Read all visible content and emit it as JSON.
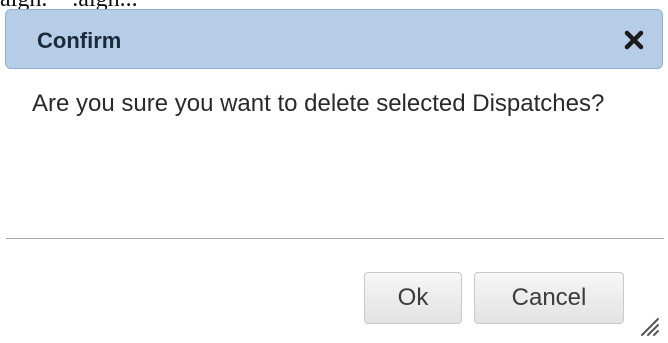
{
  "background_text": "aigh. ~ .aigh...",
  "dialog": {
    "title": "Confirm",
    "close_icon": "close-icon",
    "message": "Are you sure you want to delete selected Dispatches?",
    "ok_label": "Ok",
    "cancel_label": "Cancel",
    "resize_icon": "resize-grip-icon"
  },
  "colors": {
    "titlebar_bg": "#b6cde7",
    "titlebar_border": "#91aed4",
    "button_border": "#c9c9c9"
  }
}
